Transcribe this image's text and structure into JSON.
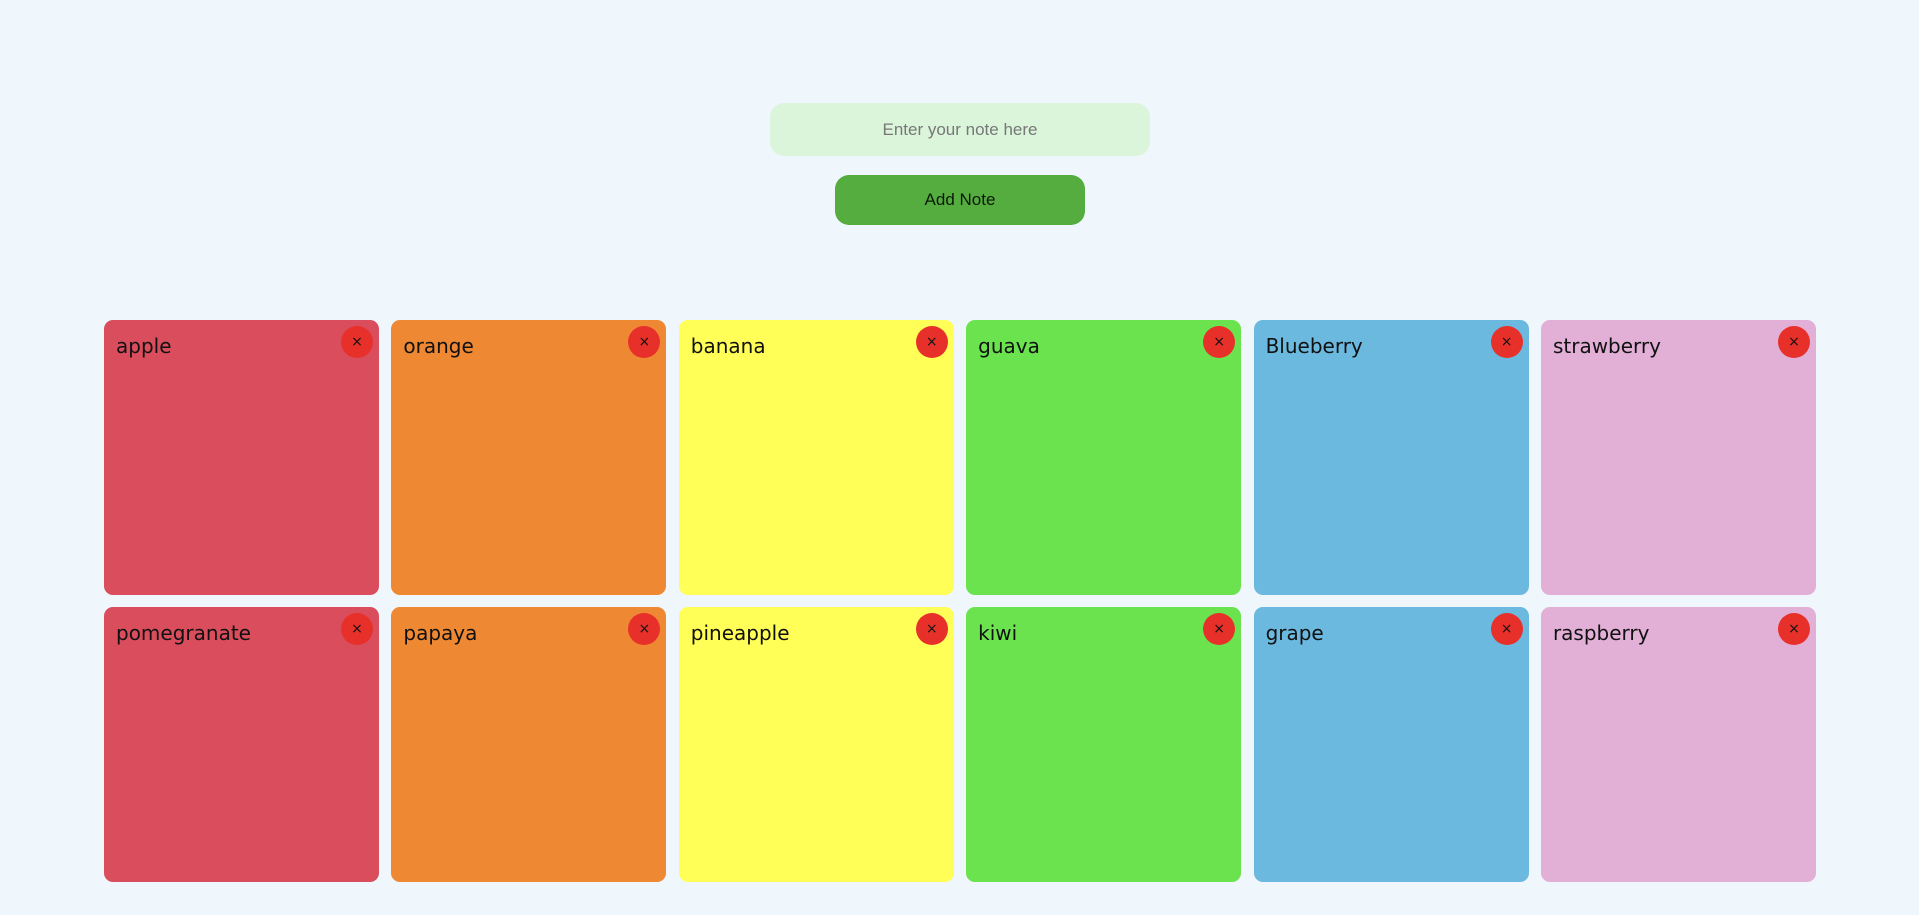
{
  "form": {
    "input_placeholder": "Enter your note here",
    "add_button_label": "Add Note"
  },
  "notes": [
    {
      "text": "apple",
      "color": "#d94d5d"
    },
    {
      "text": "orange",
      "color": "#ef8832"
    },
    {
      "text": "banana",
      "color": "#ffff57"
    },
    {
      "text": "guava",
      "color": "#6ae34e"
    },
    {
      "text": "Blueberry",
      "color": "#6bb9df"
    },
    {
      "text": "strawberry",
      "color": "#e2afd6"
    },
    {
      "text": "pomegranate",
      "color": "#d94d5d"
    },
    {
      "text": "papaya",
      "color": "#ef8832"
    },
    {
      "text": "pineapple",
      "color": "#ffff57"
    },
    {
      "text": "kiwi",
      "color": "#6ae34e"
    },
    {
      "text": "grape",
      "color": "#6bb9df"
    },
    {
      "text": "raspberry",
      "color": "#e2afd6"
    }
  ],
  "delete_glyph": "×",
  "delete_color": "#e8302a"
}
